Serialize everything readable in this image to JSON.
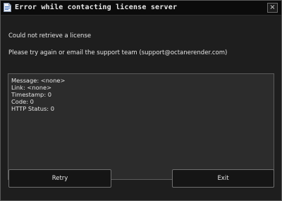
{
  "window": {
    "title": "Error while contacting license server",
    "close_glyph": "×",
    "icons": [
      "document-icon",
      "close-icon"
    ]
  },
  "body": {
    "message": "Could not retrieve a license",
    "instruction": "Please try again or email the support team (support@octanerender.com)"
  },
  "details": {
    "lines": [
      "Message: <none>",
      "Link: <none>",
      "Timestamp: 0",
      "Code: 0",
      "HTTP Status: 0"
    ]
  },
  "buttons": {
    "retry_label": "Retry",
    "exit_label": "Exit"
  },
  "colors": {
    "window_bg": "#1e1e1e",
    "titlebar_bg": "#0b0b0b",
    "details_bg": "#2c2c2c",
    "text": "#e6e6e6",
    "border": "#6e6e6e"
  }
}
